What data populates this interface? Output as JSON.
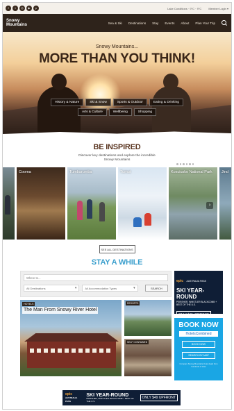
{
  "utility_bar": {
    "social_icons": [
      "facebook-icon",
      "twitter-icon",
      "instagram-icon",
      "youtube-icon",
      "pinterest-icon"
    ],
    "links": [
      "Lake Conditions · 9°C · 9°C",
      "Member Login ▾"
    ]
  },
  "nav": {
    "logo_line1": "Snowy",
    "logo_line2": "Mountains",
    "menu": [
      "Sea & Ski",
      "Destinations",
      "Stay",
      "Events",
      "About",
      "Plan Your Trip"
    ]
  },
  "hero": {
    "subtitle": "Snowy Mountains...",
    "title": "MORE THAN YOU THINK!",
    "chips": [
      "History & Nature",
      "Ski & Snow",
      "Sports & Outdoor",
      "Eating & Drinking",
      "Arts & Culture",
      "Wellbeing",
      "Shopping"
    ]
  },
  "inspired": {
    "heading": "BE INSPIRED",
    "text": "Discover key destinations and explore the incredible Snowy Mountains"
  },
  "destinations": [
    {
      "label": ""
    },
    {
      "label": "Cooma"
    },
    {
      "label": "Tumbarumba"
    },
    {
      "label": "Tumut"
    },
    {
      "label": "Kosciusko National Park"
    },
    {
      "label": "Jind"
    }
  ],
  "see_all": "SEE ALL DESTINATIONS",
  "stay": {
    "heading": "STAY A WHILE",
    "where_placeholder": "Where to...",
    "destination_select": "All Destinations",
    "accommodation_select": "All Accommodation Types",
    "search_button": "SEARCH",
    "big_card": {
      "tag": "HOTELS",
      "title": "The Man From Snowy River Hotel"
    },
    "small_cards": [
      {
        "tag": "RESORTS"
      },
      {
        "tag": "SELF CONTAINED"
      }
    ]
  },
  "ads": {
    "epic_logo": "epic",
    "epic_pass": "AUSTRALIA PASS",
    "ski_headline": "SKI YEAR-ROUND",
    "ski_sub": "PERISHER, WHISTLER BLACKCOMB + BEST OF THE U.S.",
    "price": "ONLY $49 UPFRONT",
    "book_now": "BOOK NOW",
    "hotels_combined": "HotelsCombined",
    "book_btn": "BOOK NOW",
    "map_btn": "SEARCH BY MAP",
    "fine_print": "Compare Snowy Mountains hotel deals from hundreds of sites"
  },
  "colors": {
    "nav_bg": "#2e231b",
    "brown_heading": "#5a3520",
    "blue_heading": "#3b9fcd",
    "ad_navy": "#0f1e36",
    "ad_blue": "#1aa6e4"
  }
}
